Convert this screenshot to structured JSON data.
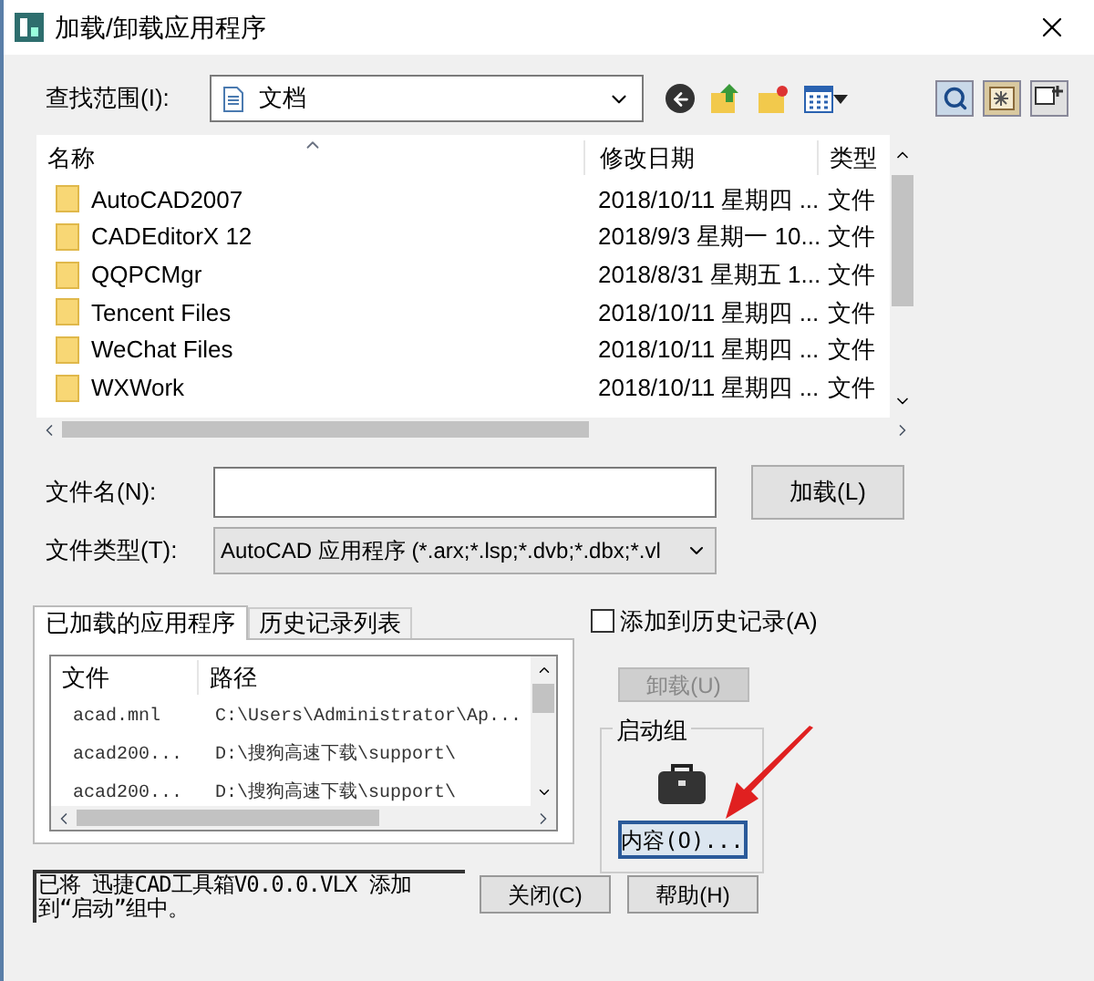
{
  "window": {
    "title": "加载/卸载应用程序"
  },
  "look_in": {
    "label": "查找范围(I):",
    "value": "文档"
  },
  "file_list": {
    "columns": [
      "名称",
      "修改日期",
      "类型"
    ],
    "rows": [
      {
        "name": "AutoCAD2007",
        "date": "2018/10/11 星期四 ...",
        "type": "文件"
      },
      {
        "name": "CADEditorX 12",
        "date": "2018/9/3 星期一 10...",
        "type": "文件"
      },
      {
        "name": "QQPCMgr",
        "date": "2018/8/31 星期五 1...",
        "type": "文件"
      },
      {
        "name": "Tencent Files",
        "date": "2018/10/11 星期四 ...",
        "type": "文件"
      },
      {
        "name": "WeChat Files",
        "date": "2018/10/11 星期四 ...",
        "type": "文件"
      },
      {
        "name": "WXWork",
        "date": "2018/10/11 星期四 ...",
        "type": "文件"
      }
    ]
  },
  "file_name": {
    "label": "文件名(N):"
  },
  "file_type": {
    "label": "文件类型(T):",
    "value": "AutoCAD 应用程序 (*.arx;*.lsp;*.dvb;*.dbx;*.vl"
  },
  "load_button": "加载(L)",
  "tabs": [
    {
      "label": "已加载的应用程序",
      "selected": true
    },
    {
      "label": "历史记录列表",
      "selected": false
    }
  ],
  "loaded_list": {
    "columns": [
      "文件",
      "路径"
    ],
    "rows": [
      {
        "file": "acad.mnl",
        "path": "C:\\Users\\Administrator\\Ap..."
      },
      {
        "file": "acad200...",
        "path": "D:\\搜狗高速下载\\support\\"
      },
      {
        "file": "acad200...",
        "path": "D:\\搜狗高速下载\\support\\"
      }
    ]
  },
  "add_to_history": {
    "label": "添加到历史记录(A)",
    "checked": false
  },
  "unload_button": {
    "label": "卸载(U)",
    "disabled": true
  },
  "startup_group": {
    "title": "启动组",
    "contents_button": "内容(O)..."
  },
  "status": "已将 迅捷CAD工具箱V0.0.0.VLX 添加到“启动”组中。",
  "buttons": [
    "关闭(C)",
    "帮助(H)"
  ]
}
